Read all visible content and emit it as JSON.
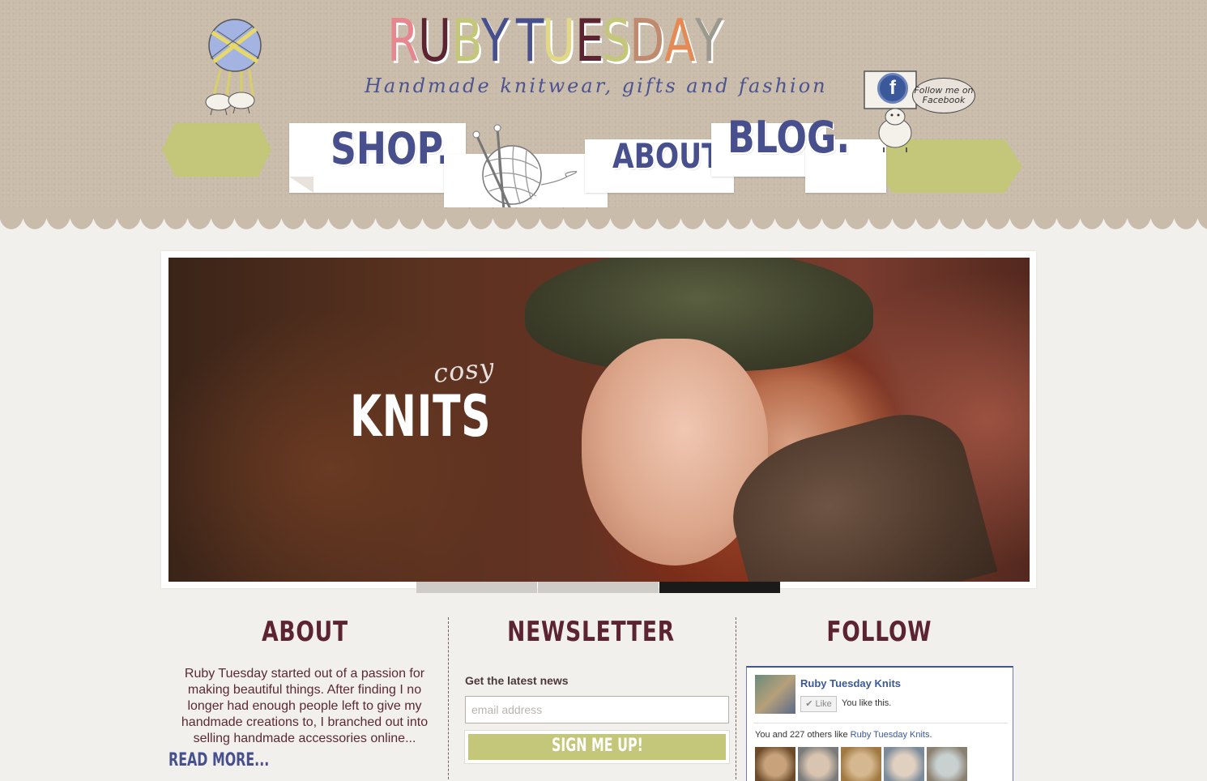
{
  "header": {
    "brand_letters": [
      {
        "char": "R",
        "color": "#e6868f"
      },
      {
        "char": "U",
        "color": "#5c2330"
      },
      {
        "char": "B",
        "color": "#c4c779"
      },
      {
        "char": "Y",
        "color": "#474f8c"
      },
      {
        "char": " ",
        "color": "#000000"
      },
      {
        "char": "T",
        "color": "#474f8c"
      },
      {
        "char": "U",
        "color": "#e0d887"
      },
      {
        "char": "E",
        "color": "#5c2330"
      },
      {
        "char": "S",
        "color": "#c4c779"
      },
      {
        "char": "D",
        "color": "#bf8a6d"
      },
      {
        "char": "A",
        "color": "#e48a55"
      },
      {
        "char": "Y",
        "color": "#9c9a8e"
      }
    ],
    "tagline": "Handmade knitwear, gifts and fashion",
    "facebook_icon": "f",
    "facebook_bubble": "Follow me on Facebook"
  },
  "nav": {
    "shop": "SHOP.",
    "about": "ABOUT.",
    "blog": "BLOG."
  },
  "slider": {
    "subtitle": "cosy",
    "title": "KNITS",
    "dots": [
      {
        "color": "#cfcbc6",
        "active": false
      },
      {
        "color": "#cfcbc6",
        "active": false
      },
      {
        "color": "#1a1a1a",
        "active": true
      }
    ]
  },
  "about": {
    "heading": "ABOUT",
    "text": "Ruby Tuesday started out of a passion for making beautiful things. After finding I no longer had enough people left to give my handmade creations to, I branched out into selling handmade accessories online...",
    "read_more": "READ MORE..."
  },
  "newsletter": {
    "heading": "NEWSLETTER",
    "label": "Get the latest news",
    "placeholder": "email address",
    "button": "SIGN ME UP!"
  },
  "follow": {
    "heading": "FOLLOW",
    "page_name": "Ruby Tuesday Knits",
    "like_button": "Like",
    "you_like": "You like this.",
    "others_prefix": "You and 227 others like ",
    "others_link": "Ruby Tuesday Knits",
    "others_suffix": ".",
    "faces": [
      "face-1",
      "face-2",
      "face-3",
      "face-4",
      "face-5"
    ]
  },
  "colors": {
    "header_bg": "#c9bcab",
    "accent_green": "#c4c779",
    "nav_blue": "#474f8c",
    "heading_maroon": "#5c2330"
  }
}
